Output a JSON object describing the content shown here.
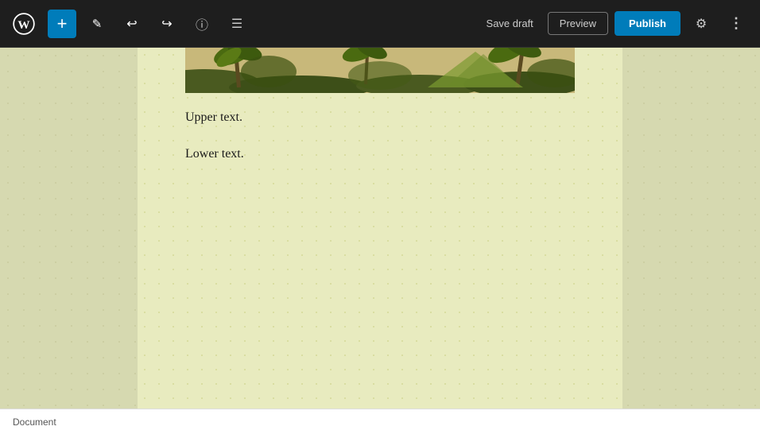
{
  "toolbar": {
    "add_label": "+",
    "save_draft_label": "Save draft",
    "preview_label": "Preview",
    "publish_label": "Publish"
  },
  "editor": {
    "upper_text": "Upper text.",
    "lower_text": "Lower text."
  },
  "status_bar": {
    "document_label": "Document"
  },
  "icons": {
    "wp_logo": "W",
    "add": "+",
    "pen": "✎",
    "undo": "↩",
    "redo": "↪",
    "info": "ⓘ",
    "list": "☰",
    "gear": "⚙",
    "more": "⋮"
  }
}
